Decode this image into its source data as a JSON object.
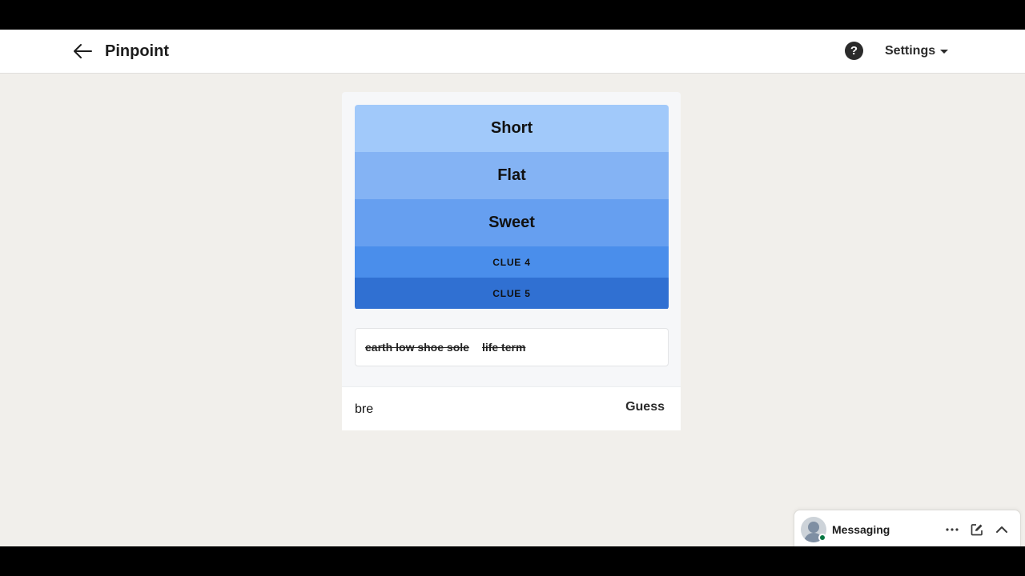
{
  "header": {
    "title": "Pinpoint",
    "help_symbol": "?",
    "settings_label": "Settings"
  },
  "clues": [
    {
      "label": "Short",
      "revealed": true,
      "color": "#a1c9fa"
    },
    {
      "label": "Flat",
      "revealed": true,
      "color": "#84b3f4"
    },
    {
      "label": "Sweet",
      "revealed": true,
      "color": "#669ff0"
    },
    {
      "label": "CLUE 4",
      "revealed": false,
      "color": "#4a8eeb"
    },
    {
      "label": "CLUE 5",
      "revealed": false,
      "color": "#3070d2"
    }
  ],
  "guesses": [
    "earth low shoe sole",
    "life term"
  ],
  "input": {
    "value": "bre",
    "guess_label": "Guess"
  },
  "messaging": {
    "label": "Messaging",
    "status_color": "#057642"
  }
}
